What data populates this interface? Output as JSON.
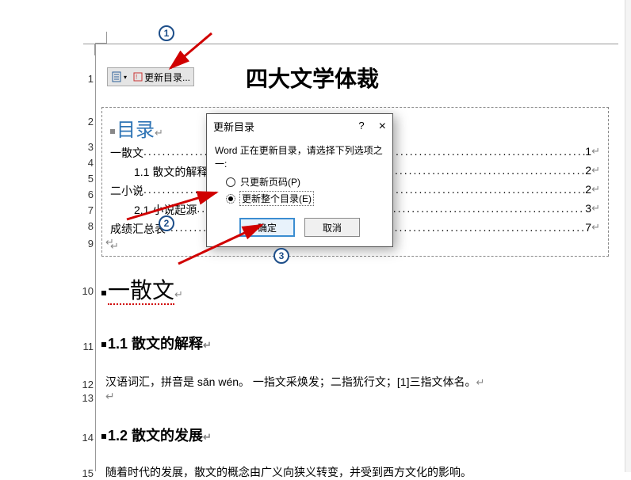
{
  "document": {
    "title": "四大文学体裁",
    "toolbar": {
      "update_label": "更新目录..."
    },
    "toc": {
      "heading": "目录",
      "lines": [
        {
          "label": "一散文",
          "page": "1",
          "indent": 0
        },
        {
          "label": "1.1 散文的解释",
          "page": "2",
          "indent": 1
        },
        {
          "label": "二小说",
          "page": "2",
          "indent": 0
        },
        {
          "label": "2.1 小说起源",
          "page": "3",
          "indent": 1
        },
        {
          "label": "成绩汇总表",
          "page": "7",
          "indent": 0
        }
      ]
    },
    "body": {
      "h1": "一散文",
      "h2a": "1.1 散文的解释",
      "p1": "汉语词汇，拼音是 sǎn wén。 一指文采焕发；二指犹行文；[1]三指文体名。",
      "h2b": "1.2 散文的发展",
      "p2": "随着时代的发展，散文的概念由广义向狭义转变，并受到西方文化的影响。"
    }
  },
  "dialog": {
    "title": "更新目录",
    "help": "?",
    "close": "×",
    "message": "Word 正在更新目录，请选择下列选项之一:",
    "opt_pages": "只更新页码(P)",
    "opt_all": "更新整个目录(E)",
    "ok": "确定",
    "cancel": "取消"
  },
  "annotations": {
    "b1": "1",
    "b2": "2",
    "b3": "3"
  },
  "line_numbers": [
    "1",
    "2",
    "3",
    "4",
    "5",
    "6",
    "7",
    "8",
    "9",
    "10",
    "11",
    "12",
    "13",
    "14",
    "15"
  ]
}
